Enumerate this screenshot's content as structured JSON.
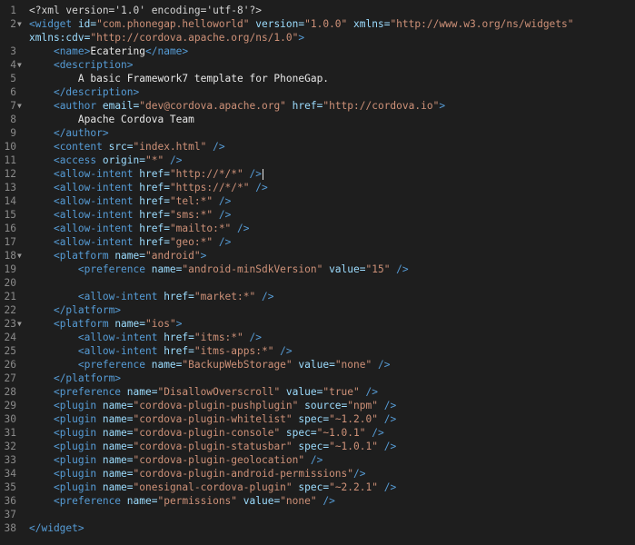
{
  "editor": {
    "language": "xml",
    "lines": [
      {
        "num": "1",
        "fold": "",
        "tokens": [
          [
            "pi",
            "<?xml version='1.0' encoding='utf-8'?>"
          ]
        ]
      },
      {
        "num": "2",
        "fold": "▼",
        "tokens": [
          [
            "tag",
            "<widget "
          ],
          [
            "attr",
            "id="
          ],
          [
            "str",
            "\"com.phonegap.helloworld\""
          ],
          [
            "attr",
            " version="
          ],
          [
            "str",
            "\"1.0.0\""
          ],
          [
            "attr",
            " xmlns="
          ],
          [
            "str",
            "\"http://www.w3.org/ns/widgets\""
          ]
        ]
      },
      {
        "num": "",
        "fold": "",
        "tokens": [
          [
            "attr",
            "xmlns:cdv="
          ],
          [
            "str",
            "\"http://cordova.apache.org/ns/1.0\""
          ],
          [
            "tag",
            ">"
          ]
        ]
      },
      {
        "num": "3",
        "fold": "",
        "tokens": [
          [
            "text",
            "    "
          ],
          [
            "tag",
            "<name>"
          ],
          [
            "text",
            "Ecatering"
          ],
          [
            "tag",
            "</name>"
          ]
        ]
      },
      {
        "num": "4",
        "fold": "▼",
        "tokens": [
          [
            "text",
            "    "
          ],
          [
            "tag",
            "<description>"
          ]
        ]
      },
      {
        "num": "5",
        "fold": "",
        "tokens": [
          [
            "text",
            "        A basic Framework7 template for PhoneGap."
          ]
        ]
      },
      {
        "num": "6",
        "fold": "",
        "tokens": [
          [
            "text",
            "    "
          ],
          [
            "tag",
            "</description>"
          ]
        ]
      },
      {
        "num": "7",
        "fold": "▼",
        "tokens": [
          [
            "text",
            "    "
          ],
          [
            "tag",
            "<author "
          ],
          [
            "attr",
            "email="
          ],
          [
            "str",
            "\"dev@cordova.apache.org\""
          ],
          [
            "attr",
            " href="
          ],
          [
            "str",
            "\"http://cordova.io\""
          ],
          [
            "tag",
            ">"
          ]
        ]
      },
      {
        "num": "8",
        "fold": "",
        "tokens": [
          [
            "text",
            "        Apache Cordova Team"
          ]
        ]
      },
      {
        "num": "9",
        "fold": "",
        "tokens": [
          [
            "text",
            "    "
          ],
          [
            "tag",
            "</author>"
          ]
        ]
      },
      {
        "num": "10",
        "fold": "",
        "tokens": [
          [
            "text",
            "    "
          ],
          [
            "tag",
            "<content "
          ],
          [
            "attr",
            "src="
          ],
          [
            "str",
            "\"index.html\""
          ],
          [
            "tag",
            " />"
          ]
        ]
      },
      {
        "num": "11",
        "fold": "",
        "tokens": [
          [
            "text",
            "    "
          ],
          [
            "tag",
            "<access "
          ],
          [
            "attr",
            "origin="
          ],
          [
            "str",
            "\"*\""
          ],
          [
            "tag",
            " />"
          ]
        ]
      },
      {
        "num": "12",
        "fold": "",
        "caret": true,
        "tokens": [
          [
            "text",
            "    "
          ],
          [
            "tag",
            "<allow-intent "
          ],
          [
            "attr",
            "href="
          ],
          [
            "str",
            "\"http://*/*\""
          ],
          [
            "tag",
            " />"
          ]
        ]
      },
      {
        "num": "13",
        "fold": "",
        "tokens": [
          [
            "text",
            "    "
          ],
          [
            "tag",
            "<allow-intent "
          ],
          [
            "attr",
            "href="
          ],
          [
            "str",
            "\"https://*/*\""
          ],
          [
            "tag",
            " />"
          ]
        ]
      },
      {
        "num": "14",
        "fold": "",
        "tokens": [
          [
            "text",
            "    "
          ],
          [
            "tag",
            "<allow-intent "
          ],
          [
            "attr",
            "href="
          ],
          [
            "str",
            "\"tel:*\""
          ],
          [
            "tag",
            " />"
          ]
        ]
      },
      {
        "num": "15",
        "fold": "",
        "tokens": [
          [
            "text",
            "    "
          ],
          [
            "tag",
            "<allow-intent "
          ],
          [
            "attr",
            "href="
          ],
          [
            "str",
            "\"sms:*\""
          ],
          [
            "tag",
            " />"
          ]
        ]
      },
      {
        "num": "16",
        "fold": "",
        "tokens": [
          [
            "text",
            "    "
          ],
          [
            "tag",
            "<allow-intent "
          ],
          [
            "attr",
            "href="
          ],
          [
            "str",
            "\"mailto:*\""
          ],
          [
            "tag",
            " />"
          ]
        ]
      },
      {
        "num": "17",
        "fold": "",
        "tokens": [
          [
            "text",
            "    "
          ],
          [
            "tag",
            "<allow-intent "
          ],
          [
            "attr",
            "href="
          ],
          [
            "str",
            "\"geo:*\""
          ],
          [
            "tag",
            " />"
          ]
        ]
      },
      {
        "num": "18",
        "fold": "▼",
        "tokens": [
          [
            "text",
            "    "
          ],
          [
            "tag",
            "<platform "
          ],
          [
            "attr",
            "name="
          ],
          [
            "str",
            "\"android\""
          ],
          [
            "tag",
            ">"
          ]
        ]
      },
      {
        "num": "19",
        "fold": "",
        "tokens": [
          [
            "text",
            "        "
          ],
          [
            "tag",
            "<preference "
          ],
          [
            "attr",
            "name="
          ],
          [
            "str",
            "\"android-minSdkVersion\""
          ],
          [
            "attr",
            " value="
          ],
          [
            "str",
            "\"15\""
          ],
          [
            "tag",
            " />"
          ]
        ]
      },
      {
        "num": "20",
        "fold": "",
        "tokens": []
      },
      {
        "num": "21",
        "fold": "",
        "tokens": [
          [
            "text",
            "        "
          ],
          [
            "tag",
            "<allow-intent "
          ],
          [
            "attr",
            "href="
          ],
          [
            "str",
            "\"market:*\""
          ],
          [
            "tag",
            " />"
          ]
        ]
      },
      {
        "num": "22",
        "fold": "",
        "tokens": [
          [
            "text",
            "    "
          ],
          [
            "tag",
            "</platform>"
          ]
        ]
      },
      {
        "num": "23",
        "fold": "▼",
        "tokens": [
          [
            "text",
            "    "
          ],
          [
            "tag",
            "<platform "
          ],
          [
            "attr",
            "name="
          ],
          [
            "str",
            "\"ios\""
          ],
          [
            "tag",
            ">"
          ]
        ]
      },
      {
        "num": "24",
        "fold": "",
        "tokens": [
          [
            "text",
            "        "
          ],
          [
            "tag",
            "<allow-intent "
          ],
          [
            "attr",
            "href="
          ],
          [
            "str",
            "\"itms:*\""
          ],
          [
            "tag",
            " />"
          ]
        ]
      },
      {
        "num": "25",
        "fold": "",
        "tokens": [
          [
            "text",
            "        "
          ],
          [
            "tag",
            "<allow-intent "
          ],
          [
            "attr",
            "href="
          ],
          [
            "str",
            "\"itms-apps:*\""
          ],
          [
            "tag",
            " />"
          ]
        ]
      },
      {
        "num": "26",
        "fold": "",
        "tokens": [
          [
            "text",
            "        "
          ],
          [
            "tag",
            "<preference "
          ],
          [
            "attr",
            "name="
          ],
          [
            "str",
            "\"BackupWebStorage\""
          ],
          [
            "attr",
            " value="
          ],
          [
            "str",
            "\"none\""
          ],
          [
            "tag",
            " />"
          ]
        ]
      },
      {
        "num": "27",
        "fold": "",
        "tokens": [
          [
            "text",
            "    "
          ],
          [
            "tag",
            "</platform>"
          ]
        ]
      },
      {
        "num": "28",
        "fold": "",
        "tokens": [
          [
            "text",
            "    "
          ],
          [
            "tag",
            "<preference "
          ],
          [
            "attr",
            "name="
          ],
          [
            "str",
            "\"DisallowOverscroll\""
          ],
          [
            "attr",
            " value="
          ],
          [
            "str",
            "\"true\""
          ],
          [
            "tag",
            " />"
          ]
        ]
      },
      {
        "num": "29",
        "fold": "",
        "tokens": [
          [
            "text",
            "    "
          ],
          [
            "tag",
            "<plugin "
          ],
          [
            "attr",
            "name="
          ],
          [
            "str",
            "\"cordova-plugin-pushplugin\""
          ],
          [
            "attr",
            " source="
          ],
          [
            "str",
            "\"npm\""
          ],
          [
            "tag",
            " />"
          ]
        ]
      },
      {
        "num": "30",
        "fold": "",
        "tokens": [
          [
            "text",
            "    "
          ],
          [
            "tag",
            "<plugin "
          ],
          [
            "attr",
            "name="
          ],
          [
            "str",
            "\"cordova-plugin-whitelist\""
          ],
          [
            "attr",
            " spec="
          ],
          [
            "str",
            "\"~1.2.0\""
          ],
          [
            "tag",
            " />"
          ]
        ]
      },
      {
        "num": "31",
        "fold": "",
        "tokens": [
          [
            "text",
            "    "
          ],
          [
            "tag",
            "<plugin "
          ],
          [
            "attr",
            "name="
          ],
          [
            "str",
            "\"cordova-plugin-console\""
          ],
          [
            "attr",
            " spec="
          ],
          [
            "str",
            "\"~1.0.1\""
          ],
          [
            "tag",
            " />"
          ]
        ]
      },
      {
        "num": "32",
        "fold": "",
        "tokens": [
          [
            "text",
            "    "
          ],
          [
            "tag",
            "<plugin "
          ],
          [
            "attr",
            "name="
          ],
          [
            "str",
            "\"cordova-plugin-statusbar\""
          ],
          [
            "attr",
            " spec="
          ],
          [
            "str",
            "\"~1.0.1\""
          ],
          [
            "tag",
            " />"
          ]
        ]
      },
      {
        "num": "33",
        "fold": "",
        "tokens": [
          [
            "text",
            "    "
          ],
          [
            "tag",
            "<plugin "
          ],
          [
            "attr",
            "name="
          ],
          [
            "str",
            "\"cordova-plugin-geolocation\""
          ],
          [
            "tag",
            " />"
          ]
        ]
      },
      {
        "num": "34",
        "fold": "",
        "tokens": [
          [
            "text",
            "    "
          ],
          [
            "tag",
            "<plugin "
          ],
          [
            "attr",
            "name="
          ],
          [
            "str",
            "\"cordova-plugin-android-permissions\""
          ],
          [
            "tag",
            "/>"
          ]
        ]
      },
      {
        "num": "35",
        "fold": "",
        "tokens": [
          [
            "text",
            "    "
          ],
          [
            "tag",
            "<plugin "
          ],
          [
            "attr",
            "name="
          ],
          [
            "str",
            "\"onesignal-cordova-plugin\""
          ],
          [
            "attr",
            " spec="
          ],
          [
            "str",
            "\"~2.2.1\""
          ],
          [
            "tag",
            " />"
          ]
        ]
      },
      {
        "num": "36",
        "fold": "",
        "tokens": [
          [
            "text",
            "    "
          ],
          [
            "tag",
            "<preference "
          ],
          [
            "attr",
            "name="
          ],
          [
            "str",
            "\"permissions\""
          ],
          [
            "attr",
            " value="
          ],
          [
            "str",
            "\"none\""
          ],
          [
            "tag",
            " />"
          ]
        ]
      },
      {
        "num": "37",
        "fold": "",
        "tokens": []
      },
      {
        "num": "38",
        "fold": "",
        "tokens": [
          [
            "tag",
            "</widget>"
          ]
        ]
      }
    ]
  },
  "colors": {
    "background": "#1e1e1e",
    "tag": "#569cd6",
    "attribute": "#9cdcfe",
    "string": "#ce9178",
    "text": "#e6e6e6",
    "gutter": "#8a8a8a"
  }
}
